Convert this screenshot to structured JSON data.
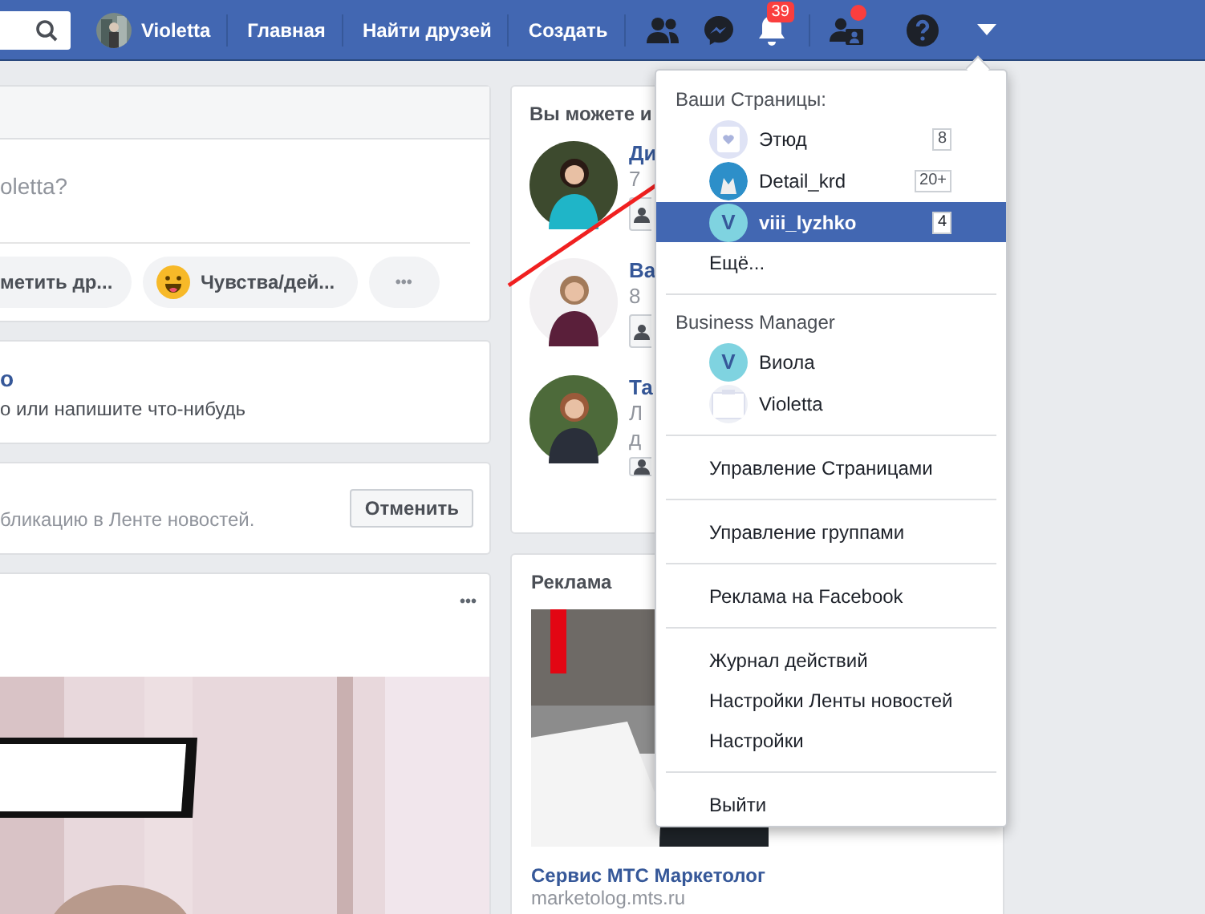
{
  "topbar": {
    "user": "Violetta",
    "links": [
      "Главная",
      "Найти друзей",
      "Создать"
    ],
    "notifications_count": "39",
    "requests_dot": true
  },
  "composer": {
    "placeholder": "oletta?",
    "actions": [
      {
        "kind": "tag",
        "label": "метить др..."
      },
      {
        "kind": "feeling",
        "label": "Чувства/дей..."
      },
      {
        "kind": "more",
        "label": "•••"
      }
    ]
  },
  "prompt_card": {
    "title": "о",
    "text": "о или напишите что-нибудь"
  },
  "hidden_card": {
    "text": "бликацию в Ленте новостей.",
    "button": "Отменить"
  },
  "post": {
    "more": "•••"
  },
  "people": {
    "title": "Вы можете и",
    "items": [
      {
        "name": "Ди",
        "lines": [
          "7"
        ]
      },
      {
        "name": "Ва",
        "lines": [
          "8"
        ]
      },
      {
        "name": "Та",
        "lines": [
          "Л",
          "д"
        ]
      }
    ]
  },
  "ad": {
    "title": "Реклама",
    "headline": "Сервис МТС Маркетолог",
    "url": "marketolog.mts.ru"
  },
  "menu": {
    "pages_header": "Ваши Страницы:",
    "pages": [
      {
        "name": "Этюд",
        "avatar": {
          "kind": "heart"
        },
        "count": "8",
        "selected": false
      },
      {
        "name": "Detail_krd",
        "count": "20+",
        "selected": false
      },
      {
        "name": "viii_lyzhko",
        "avatar": {
          "kind": "letter",
          "letter": "V"
        },
        "count": "4",
        "selected": true
      }
    ],
    "more": "Ещё...",
    "bm_header": "Business Manager",
    "bm": [
      {
        "name": "Виола",
        "avatar": {
          "kind": "letter",
          "letter": "V"
        }
      },
      {
        "name": "Violetta",
        "avatar": {
          "kind": "blank"
        }
      }
    ],
    "groups": [
      [
        "Управление Страницами"
      ],
      [
        "Управление группами"
      ],
      [
        "Реклама на Facebook"
      ],
      [
        "Журнал действий",
        "Настройки Ленты новостей",
        "Настройки"
      ],
      [
        "Выйти"
      ]
    ]
  }
}
